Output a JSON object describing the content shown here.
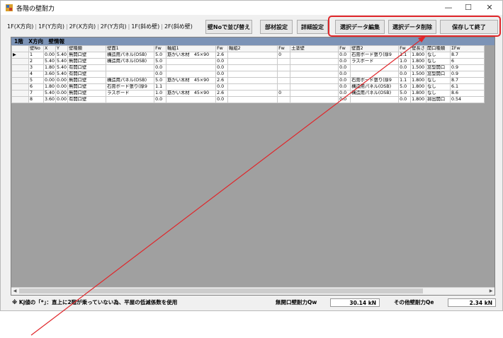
{
  "window": {
    "title": "各階の壁耐力",
    "minimize": "—",
    "maximize": "☐",
    "close": "✕"
  },
  "tabs": [
    "1F(X方向)",
    "1F(Y方向)",
    "2F(X方向)",
    "2F(Y方向)",
    "1F(斜め壁)",
    "2F(斜め壁)"
  ],
  "buttons": {
    "sort": "壁Noで並び替え",
    "material": "部材設定",
    "detail": "詳細設定",
    "edit": "選択データ編集",
    "delete": "選択データ削除",
    "save_exit": "保存して終了"
  },
  "grid": {
    "title": "1階　X方向　壁情報",
    "columns": [
      "壁No",
      "X",
      "Y",
      "壁種類",
      "壁面1",
      "Fw",
      "軸組1",
      "Fw",
      "軸組2",
      "Fw",
      "土塗壁",
      "Fw",
      "壁面2",
      "Fw",
      "壁長さ",
      "開口種類",
      "ΣFw"
    ],
    "rows": [
      [
        "1",
        "0.00",
        "5.40",
        "無開口壁",
        "構造用パネル(OSB)",
        "5.0",
        "筋かい木材　45×90",
        "2.6",
        "",
        "0",
        "",
        "0.0",
        "石膏ボード張り(厚9",
        "1.1",
        "1.800",
        "なし",
        "8.7"
      ],
      [
        "2",
        "5.40",
        "5.40",
        "無開口壁",
        "構造用パネル(OSB)",
        "5.0",
        "",
        "0.0",
        "",
        "",
        "",
        "0.0",
        "ラスボード",
        "1.0",
        "1.800",
        "なし",
        "6"
      ],
      [
        "3",
        "1.80",
        "5.40",
        "有開口壁",
        "",
        "0.0",
        "",
        "0.0",
        "",
        "",
        "",
        "0.0",
        "",
        "0.0",
        "1.500",
        "窓型開口",
        "0.9"
      ],
      [
        "4",
        "3.60",
        "5.40",
        "有開口壁",
        "",
        "0.0",
        "",
        "0.0",
        "",
        "",
        "",
        "0.0",
        "",
        "0.0",
        "1.500",
        "窓型開口",
        "0.9"
      ],
      [
        "5",
        "0.00",
        "0.00",
        "無開口壁",
        "構造用パネル(OSB)",
        "5.0",
        "筋かい木材　45×90",
        "2.6",
        "",
        "",
        "",
        "0.0",
        "石膏ボード張り(厚9",
        "1.1",
        "1.800",
        "なし",
        "8.7"
      ],
      [
        "6",
        "1.80",
        "0.00",
        "無開口壁",
        "石膏ボード張り(厚9",
        "1.1",
        "",
        "0.0",
        "",
        "",
        "",
        "0.0",
        "構造用パネル(OSB)",
        "5.0",
        "1.800",
        "なし",
        "6.1"
      ],
      [
        "7",
        "5.40",
        "0.00",
        "無開口壁",
        "ラスボード",
        "1.0",
        "筋かい木材　45×90",
        "2.6",
        "",
        "0",
        "",
        "0.0",
        "構造用パネル(OSB)",
        "5.0",
        "1.800",
        "なし",
        "8.6"
      ],
      [
        "8",
        "3.60",
        "0.00",
        "有開口壁",
        "",
        "0.0",
        "",
        "0.0",
        "",
        "",
        "",
        "0.0",
        "",
        "0.0",
        "1.800",
        "掃出開口",
        "0.54"
      ]
    ]
  },
  "status": {
    "note": "※ Kj値の「*」：直上に2階が乗っていない為、平屋の低減係数を使用",
    "qw_label": "無開口壁耐力Qw",
    "qw_value": "30.14 kN",
    "qe_label": "その他壁耐力Qe",
    "qe_value": "2.34 kN"
  },
  "colors": {
    "highlight": "#e0262a",
    "grid_title_bg": "#7c93b6",
    "grid_bg": "#a0a0a0"
  }
}
